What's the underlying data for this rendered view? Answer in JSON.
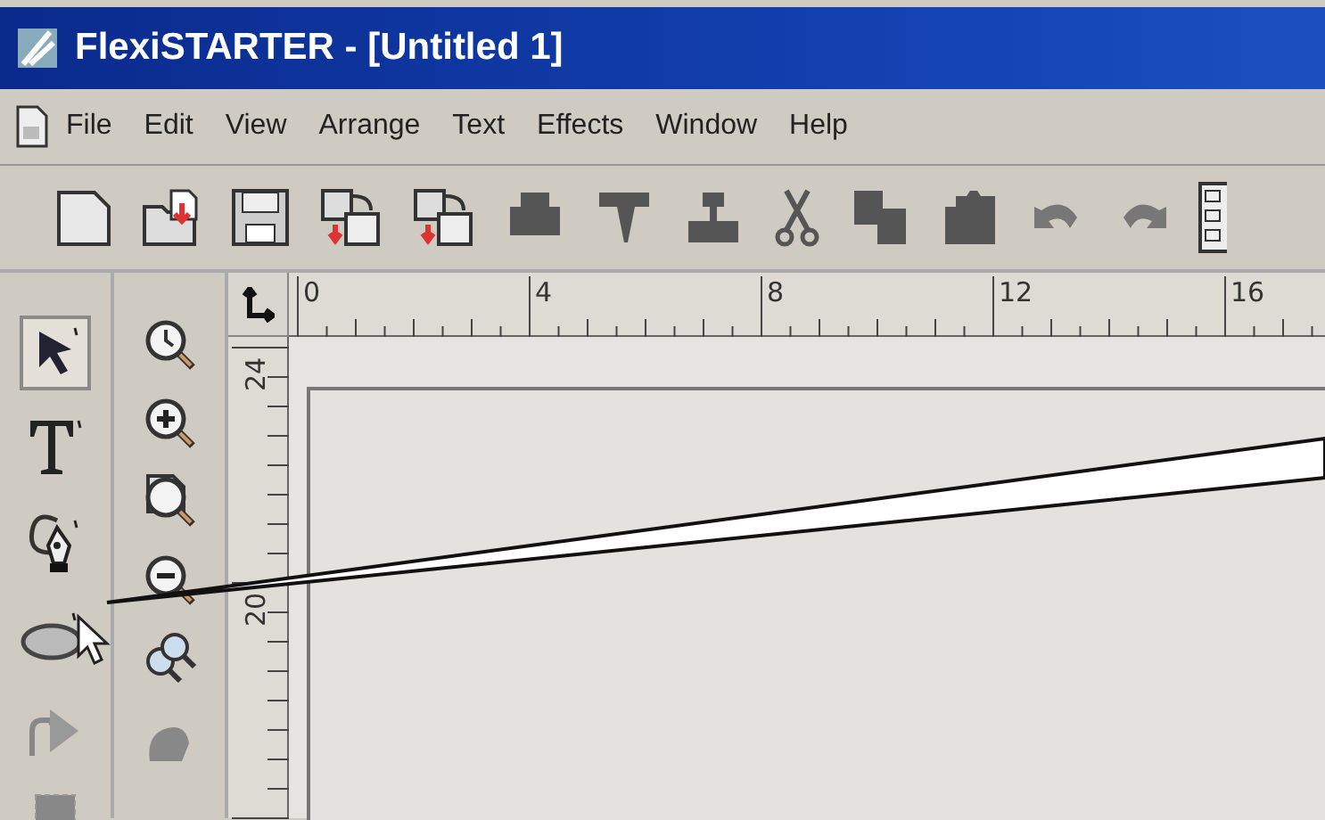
{
  "window": {
    "title": "FlexiSTARTER - [Untitled 1]"
  },
  "menu": [
    "File",
    "Edit",
    "View",
    "Arrange",
    "Text",
    "Effects",
    "Window",
    "Help"
  ],
  "toolbar": [
    {
      "kind": "new"
    },
    {
      "kind": "open"
    },
    {
      "kind": "save"
    },
    {
      "kind": "import"
    },
    {
      "kind": "export"
    },
    {
      "kind": "print"
    },
    {
      "kind": "cutter"
    },
    {
      "kind": "stamp"
    },
    {
      "kind": "cut"
    },
    {
      "kind": "copy"
    },
    {
      "kind": "paste"
    },
    {
      "kind": "undo"
    },
    {
      "kind": "redo"
    },
    {
      "kind": "props"
    }
  ],
  "tools": [
    {
      "kind": "select",
      "selected": true
    },
    {
      "kind": "text",
      "selected": false
    },
    {
      "kind": "pen",
      "selected": false
    },
    {
      "kind": "ellipse",
      "selected": false
    },
    {
      "kind": "node",
      "selected": false
    },
    {
      "kind": "rect",
      "selected": false
    }
  ],
  "zoom_tools": [
    {
      "kind": "zoom-area"
    },
    {
      "kind": "zoom-in"
    },
    {
      "kind": "zoom-page"
    },
    {
      "kind": "zoom-out"
    },
    {
      "kind": "zoom-all"
    },
    {
      "kind": "pan"
    }
  ],
  "horizontal_ruler": [
    "0",
    "4",
    "8",
    "12",
    "16"
  ],
  "vertical_ruler": [
    "24",
    "20"
  ]
}
